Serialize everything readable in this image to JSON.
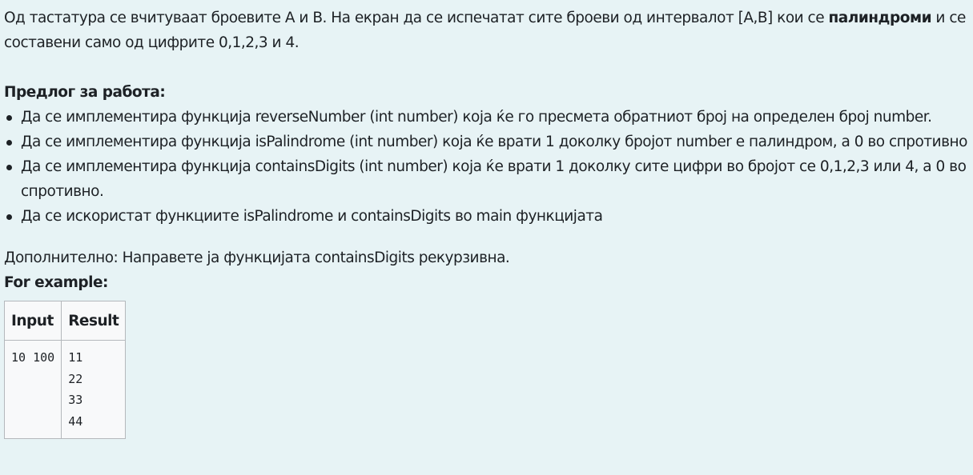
{
  "problem": {
    "intro_before_bold": "Од тастатура се вчитуваат броевите А и B. На екран да се испечатат сите броеви од интервалот [A,B] кои се ",
    "intro_bold": "палиндроми",
    "intro_after_bold": " и се составени само од цифрите 0,1,2,3 и 4.",
    "proposal_heading": "Предлог за работа:",
    "tasks": [
      "Да се имплементира функција reverseNumber (int number) која ќе го пресмета обратниот број на определен број number.",
      "Да се имплементира функција isPalindrome (int number) која ќе врати 1 доколку бројот number е палиндром, а 0 во спротивно",
      "Да се имплементира функција containsDigits (int number) која ќе врати 1 доколку сите цифри во бројот се 0,1,2,3 или 4, а 0 во спротивно.",
      "Да се искористат функциите isPalindrome и containsDigits во main функцијата"
    ],
    "additional": "Дополнително: Направете ја функцијата containsDigits рекурзивна.",
    "example_heading": "For example:"
  },
  "example_table": {
    "headers": [
      "Input",
      "Result"
    ],
    "rows": [
      {
        "input": "10 100",
        "result": "11\n22\n33\n44"
      }
    ]
  }
}
